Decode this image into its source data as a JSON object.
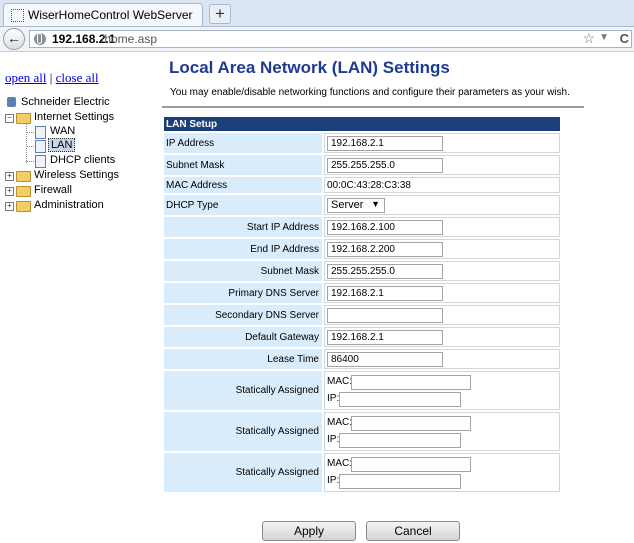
{
  "browser": {
    "tab_title": "WiserHomeControl WebServer",
    "new_tab_label": "+",
    "url_host": "192.168.2.1",
    "url_path": "/home.asp"
  },
  "tree": {
    "open_all": "open all",
    "separator": "|",
    "close_all": "close all",
    "root": "Schneider Electric",
    "items": [
      {
        "label": "Internet Settings"
      },
      {
        "label": "WAN"
      },
      {
        "label": "LAN"
      },
      {
        "label": "DHCP clients"
      },
      {
        "label": "Wireless Settings"
      },
      {
        "label": "Firewall"
      },
      {
        "label": "Administration"
      }
    ]
  },
  "page": {
    "title": "Local Area Network (LAN) Settings",
    "description": "You may enable/disable networking functions and configure their parameters as your wish."
  },
  "lan_setup": {
    "header": "LAN Setup",
    "ip_address_label": "IP Address",
    "ip_address": "192.168.2.1",
    "subnet_mask_label": "Subnet Mask",
    "subnet_mask": "255.255.255.0",
    "mac_address_label": "MAC Address",
    "mac_address": "00:0C:43:28:C3:38",
    "dhcp_type_label": "DHCP Type",
    "dhcp_type": "Server",
    "dhcp": {
      "start_ip_label": "Start IP Address",
      "start_ip": "192.168.2.100",
      "end_ip_label": "End IP Address",
      "end_ip": "192.168.2.200",
      "subnet_mask_label": "Subnet Mask",
      "subnet_mask": "255.255.255.0",
      "primary_dns_label": "Primary DNS Server",
      "primary_dns": "192.168.2.1",
      "secondary_dns_label": "Secondary DNS Server",
      "secondary_dns": "",
      "default_gateway_label": "Default Gateway",
      "default_gateway": "192.168.2.1",
      "lease_time_label": "Lease Time",
      "lease_time": "86400",
      "static_label": "Statically Assigned",
      "mac_key": "MAC:",
      "ip_key": "IP:"
    }
  },
  "buttons": {
    "apply": "Apply",
    "cancel": "Cancel"
  }
}
